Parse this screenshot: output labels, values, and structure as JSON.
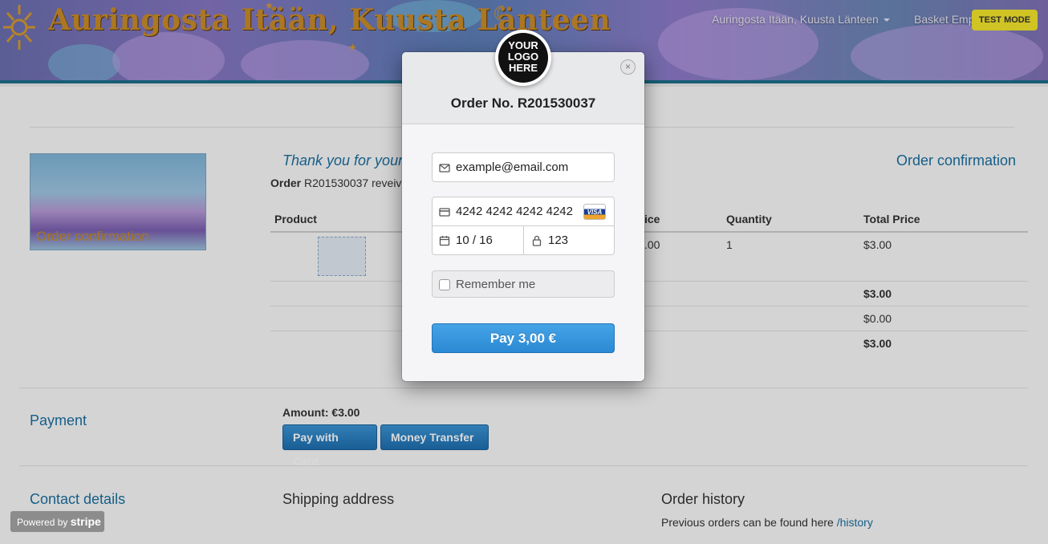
{
  "header": {
    "site_title": "Auringosta Itään, Kuusta Länteen",
    "nav_site": "Auringosta Itään, Kuusta Länteen",
    "nav_basket": "Basket Emp",
    "test_mode": "TEST MODE"
  },
  "order_page": {
    "thumbnail_label": "Order confirmation",
    "thank_you": "Thank you for your",
    "heading": "Order confirmation",
    "order_label": "Order",
    "order_text": "R201530037 reveiv",
    "table": {
      "headers": [
        "Product",
        "ice",
        "Quantity",
        "Total Price"
      ],
      "row": {
        "price": ".00",
        "quantity": "1",
        "total": "$3.00"
      },
      "subtotal": "$3.00",
      "shipping": "$0.00",
      "grand_total": "$3.00"
    },
    "payment": {
      "title": "Payment",
      "amount": "Amount: €3.00",
      "pay_card": "Pay with Card",
      "money_transfer": "Money Transfer"
    },
    "contact_title": "Contact details",
    "shipping_title": "Shipping address",
    "history_title": "Order history",
    "history_text": "Previous orders can be found here",
    "history_link": "/history"
  },
  "modal": {
    "logo_text": "YOUR LOGO HERE",
    "close": "×",
    "title": "Order No. R201530037",
    "email": "example@email.com",
    "card_number": "4242 4242 4242 4242",
    "card_brand": "VISA",
    "expiry": "10 / 16",
    "cvc": "123",
    "remember_label": "Remember me",
    "pay_label": "Pay 3,00 €"
  },
  "stripe_badge": {
    "prefix": "Powered by",
    "brand": "stripe"
  },
  "colors": {
    "accent": "#1a6fa0",
    "pay_button": "#2b89d4",
    "test_mode": "#f5e62b"
  }
}
